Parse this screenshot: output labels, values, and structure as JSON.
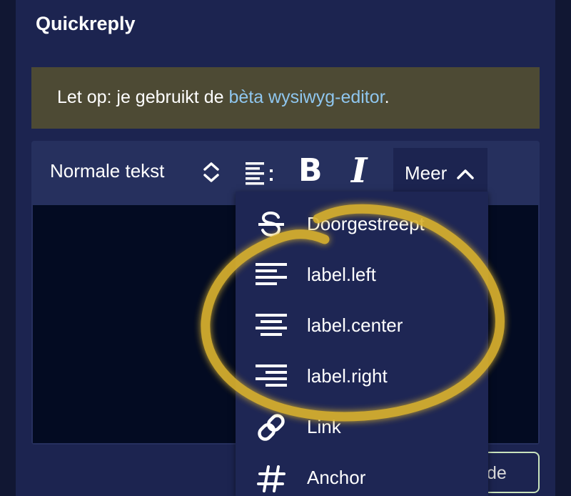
{
  "page": {
    "title": "Quickreply"
  },
  "notice": {
    "text_before": "Let op: je gebruikt de ",
    "link_text": "bèta wysiwyg-editor",
    "text_after": "."
  },
  "toolbar": {
    "format_select": "Normale tekst",
    "bold_label": "B",
    "italic_label": "I",
    "more_label": "Meer"
  },
  "dropdown": {
    "items": [
      {
        "label": "Doorgestreept",
        "icon": "strikethrough-icon"
      },
      {
        "label": "label.left",
        "icon": "align-left-icon"
      },
      {
        "label": "label.center",
        "icon": "align-center-icon"
      },
      {
        "label": "label.right",
        "icon": "align-right-icon"
      },
      {
        "label": "Link",
        "icon": "link-icon"
      },
      {
        "label": "Anchor",
        "icon": "hash-icon"
      }
    ]
  },
  "submit": {
    "partial_label": "de"
  },
  "colors": {
    "background": "#1c2450",
    "notice_bg": "#4d4a34",
    "link": "#8fc6ee",
    "editor_area": "#030b22",
    "annotation_circle": "#d9b12e"
  }
}
